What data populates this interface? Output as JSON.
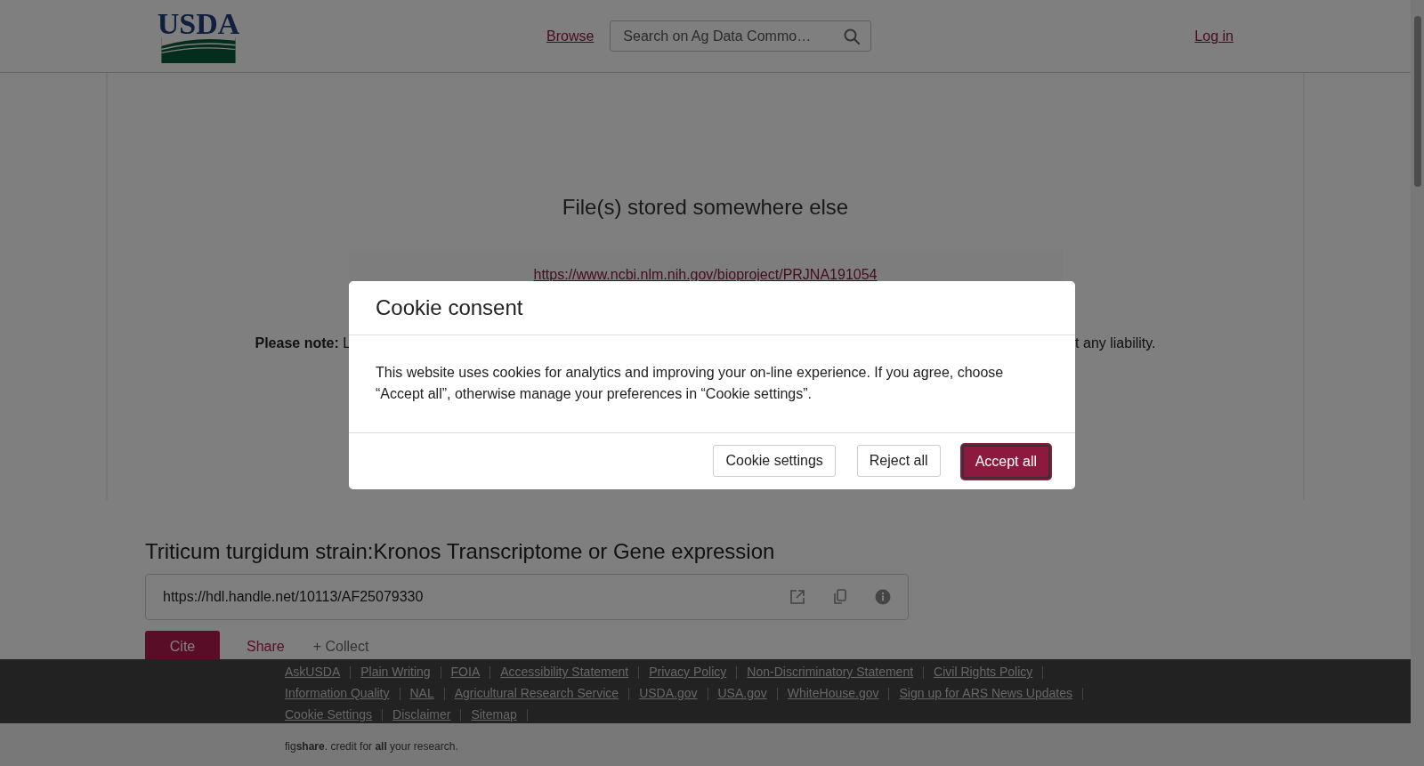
{
  "header": {
    "logo_text": "USDA",
    "browse_link": "Browse",
    "search": {
      "placeholder": "Search on Ag Data Commo…"
    },
    "login_link": "Log in"
  },
  "preview": {
    "title": "File(s) stored somewhere else",
    "link": "https://www.ncbi.nlm.nih.gov/bioproject/PRJNA191054",
    "note_start": "**Please note:** L",
    "note_end": "t any liability."
  },
  "item": {
    "title": "Triticum turgidum strain:Kronos Transcriptome or Gene expression",
    "handle": "https://hdl.handle.net/10113/AF25079330",
    "actions": [
      {
        "kind": "primary",
        "label": "Cite"
      },
      {
        "kind": "link",
        "label": "Share"
      },
      {
        "kind": "plain",
        "label": "+ Collect"
      }
    ]
  },
  "footer": {
    "links": [
      "AskUSDA",
      "Plain Writing",
      "FOIA",
      "Accessibility Statement",
      "Privacy Policy",
      "Non-Discriminatory Statement",
      "Civil Rights Policy",
      "Information Quality",
      "NAL",
      "Agricultural Research Service",
      "USDA.gov",
      "USA.gov",
      "WhiteHouse.gov",
      "Sign up for ARS News Updates",
      "Cookie Settings",
      "Disclaimer",
      "Sitemap"
    ],
    "tagline": "fig**share**. credit for **all** your research."
  },
  "cookie_dialog": {
    "title": "Cookie consent",
    "text": "This website uses cookies for analytics and improving your on-line experience. If you agree, choose “Accept all”, otherwise manage your preferences in “Cookie settings”.",
    "buttons": [
      {
        "kind": "secondary",
        "label": "Cookie settings"
      },
      {
        "kind": "secondary",
        "label": "Reject all"
      },
      {
        "kind": "primary",
        "label": "Accept all"
      }
    ]
  }
}
